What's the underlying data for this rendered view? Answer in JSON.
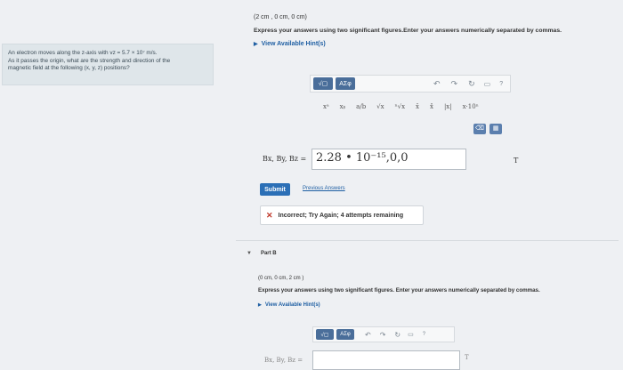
{
  "left_panel": {
    "line1": "An electron moves along the z-axis with vz = 5.7 × 10⁷ m/s.",
    "line2": "As it passes the origin, what are the strength and direction of the",
    "line3": "magnetic field at the following (x, y, z) positions?"
  },
  "part_a": {
    "position": "(2 cm , 0 cm, 0 cm)",
    "instructions": "Express your answers using two significant figures.Enter your answers numerically separated by commas.",
    "hints_link": "View Available Hint(s)",
    "toolbar": {
      "template_label": "√▢",
      "greek_label": "ΑΣφ",
      "help": "?"
    },
    "symbols": [
      "xᵃ",
      "xᵦ",
      "a/b",
      "√x",
      "ⁿ√x",
      "x̄",
      "x̂",
      "|x|",
      "x·10ⁿ"
    ],
    "answer_label": "Bx, By, Bz =",
    "answer_value": "2.28 • 10⁻¹⁵,0,0",
    "unit": "T",
    "submit_label": "Submit",
    "previous_answers_label": "Previous Answers",
    "feedback_text": "Incorrect; Try Again; 4 attempts remaining"
  },
  "part_b": {
    "title": "Part B",
    "position": "(0 cm, 0 cm, 2 cm )",
    "instructions": "Express your answers using two significant figures. Enter your answers numerically separated by commas.",
    "hints_link": "View Available Hint(s)",
    "toolbar": {
      "template_label": "√▢",
      "greek_label": "ΑΣφ",
      "help": "?"
    },
    "answer_label": "Bx, By, Bz =",
    "unit": "T"
  }
}
